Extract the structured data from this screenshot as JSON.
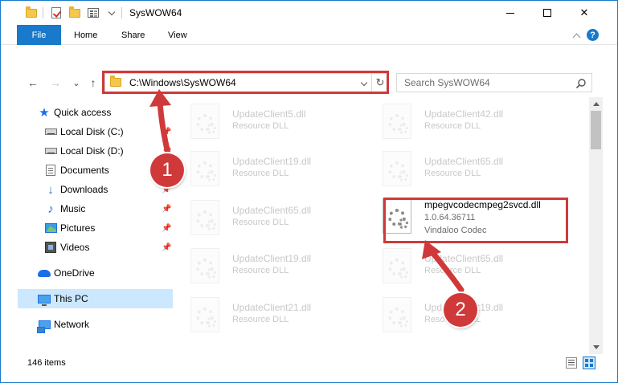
{
  "window": {
    "title": "SysWOW64",
    "minimize_symbol": "—",
    "close_symbol": "✕"
  },
  "ribbon": {
    "tabs": [
      {
        "label": "File"
      },
      {
        "label": "Home"
      },
      {
        "label": "Share"
      },
      {
        "label": "View"
      }
    ],
    "help_symbol": "?"
  },
  "navigation": {
    "back_symbol": "←",
    "forward_symbol": "→",
    "recent_symbol": "⌄",
    "up_symbol": "↑",
    "address": "C:\\Windows\\SysWOW64",
    "refresh_symbol": "↻",
    "search_placeholder": "Search SysWOW64"
  },
  "sidebar": {
    "items": [
      {
        "label": "Quick access",
        "icon": "star-icon"
      },
      {
        "label": "Local Disk (C:)",
        "icon": "drive-icon",
        "pinned": true
      },
      {
        "label": "Local Disk (D:)",
        "icon": "drive-icon",
        "pinned": true
      },
      {
        "label": "Documents",
        "icon": "documents-icon",
        "pinned": true
      },
      {
        "label": "Downloads",
        "icon": "downloads-icon",
        "pinned": true
      },
      {
        "label": "Music",
        "icon": "music-icon",
        "pinned": true
      },
      {
        "label": "Pictures",
        "icon": "pictures-icon",
        "pinned": true
      },
      {
        "label": "Videos",
        "icon": "videos-icon",
        "pinned": true
      },
      {
        "label": "OneDrive",
        "icon": "onedrive-icon"
      },
      {
        "label": "This PC",
        "icon": "pc-icon",
        "selected": true
      },
      {
        "label": "Network",
        "icon": "network-icon"
      }
    ],
    "pin_symbol": "📌"
  },
  "files": [
    {
      "name": "UpdateClient5.dll",
      "sub": "Resource DLL",
      "faded": true
    },
    {
      "name": "UpdateClient42.dll",
      "sub": "Resource DLL",
      "faded": true
    },
    {
      "name": "UpdateClient19.dll",
      "sub": "Resource DLL",
      "faded": true
    },
    {
      "name": "UpdateClient65.dll",
      "sub": "Resource DLL",
      "faded": true
    },
    {
      "name": "UpdateClient65.dll",
      "sub": "Resource DLL",
      "faded": true
    },
    {
      "name": "mpegvcodecmpeg2svcd.dll",
      "sub": "1.0.64.36711",
      "sub2": "Vindaloo Codec",
      "faded": false
    },
    {
      "name": "UpdateClient19.dll",
      "sub": "Resource DLL",
      "faded": true
    },
    {
      "name": "UpdateClient65.dll",
      "sub": "Resource DLL",
      "faded": true
    },
    {
      "name": "UpdateClient21.dll",
      "sub": "Resource DLL",
      "faded": true
    },
    {
      "name": "UpdateClient19.dll",
      "sub": "Resource DLL",
      "faded": true
    }
  ],
  "status": {
    "item_count": "146 items"
  },
  "annotations": {
    "step1": "1",
    "step2": "2",
    "color": "#d0393a"
  }
}
